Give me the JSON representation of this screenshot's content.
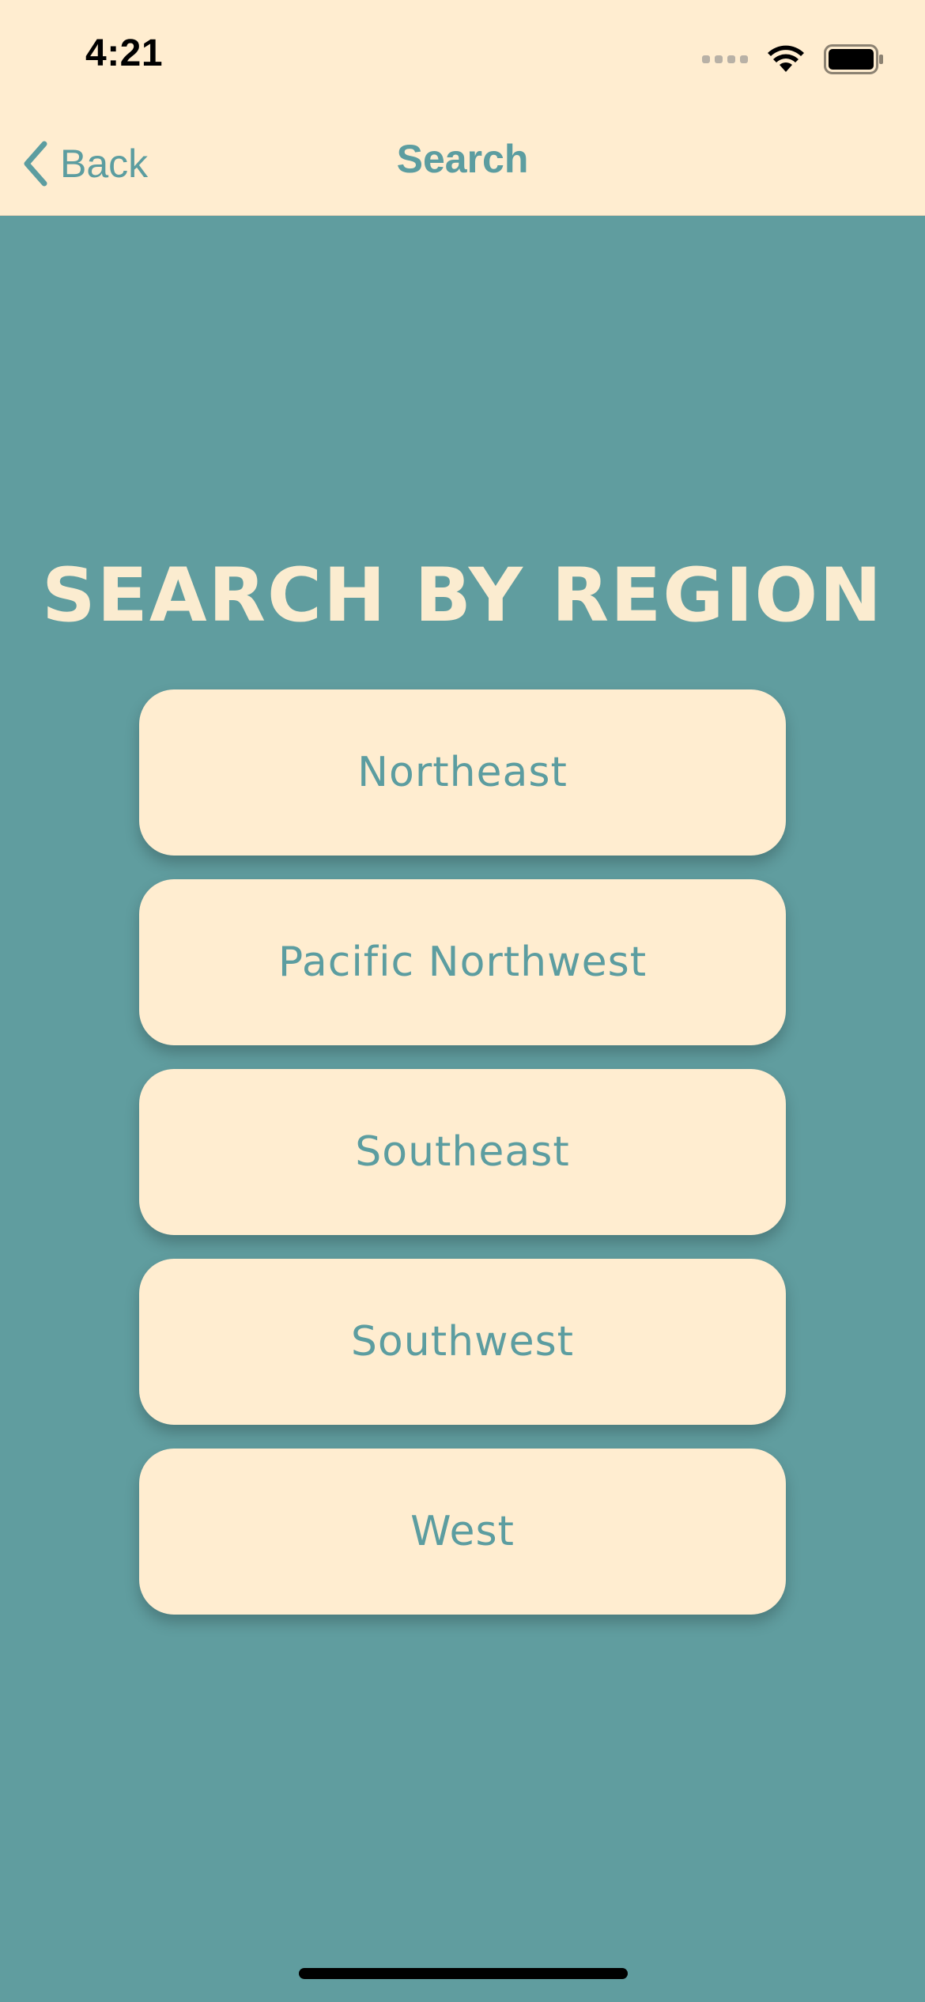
{
  "status_bar": {
    "time": "4:21",
    "icons": [
      "cellular-signal-icon",
      "wifi-icon",
      "battery-icon"
    ]
  },
  "nav": {
    "back_label": "Back",
    "title": "Search",
    "back_icon": "chevron-left-icon"
  },
  "main": {
    "heading": "SEARCH BY REGION",
    "regions": [
      {
        "label": "Northeast"
      },
      {
        "label": "Pacific Northwest"
      },
      {
        "label": "Southeast"
      },
      {
        "label": "Southwest"
      },
      {
        "label": "West"
      }
    ]
  },
  "colors": {
    "background": "#609d9f",
    "bar_background": "#ffedd0",
    "accent": "#5c9da0",
    "heading_text": "#fbecd0"
  }
}
